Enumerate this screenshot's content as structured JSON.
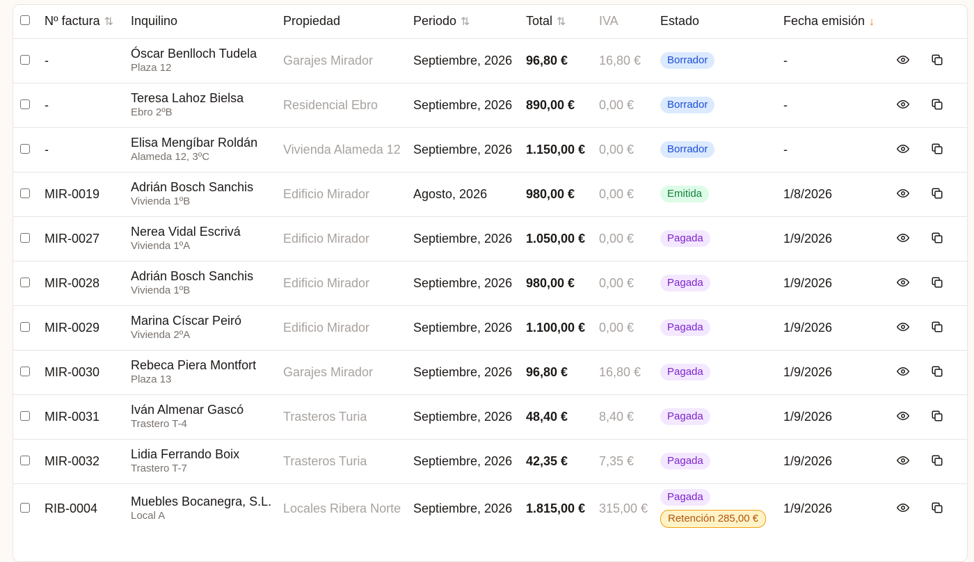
{
  "headers": {
    "invoice_no": "Nº factura",
    "tenant": "Inquilino",
    "property": "Propiedad",
    "period": "Periodo",
    "total": "Total",
    "vat": "IVA",
    "status": "Estado",
    "issue_date": "Fecha emisión"
  },
  "icons": {
    "sort": "sort-icon",
    "sort_active": "sort-desc-icon",
    "view": "eye-icon",
    "copy": "copy-icon"
  },
  "colors": {
    "accent": "#f97316",
    "draft": "#1d4ed8",
    "issued": "#15803d",
    "paid": "#7e22ce",
    "retention": "#b45309"
  },
  "rows": [
    {
      "invoice": "-",
      "tenant": "Óscar Benlloch Tudela",
      "unit": "Plaza 12",
      "property": "Garajes Mirador",
      "period": "Septiembre, 2026",
      "total": "96,80 €",
      "vat": "16,80 €",
      "status": "Borrador",
      "status_kind": "draft",
      "date": "-"
    },
    {
      "invoice": "-",
      "tenant": "Teresa Lahoz Bielsa",
      "unit": "Ebro 2ºB",
      "property": "Residencial Ebro",
      "period": "Septiembre, 2026",
      "total": "890,00 €",
      "vat": "0,00 €",
      "status": "Borrador",
      "status_kind": "draft",
      "date": "-"
    },
    {
      "invoice": "-",
      "tenant": "Elisa Mengíbar Roldán",
      "unit": "Alameda 12, 3ºC",
      "property": "Vivienda Alameda 12",
      "period": "Septiembre, 2026",
      "total": "1.150,00 €",
      "vat": "0,00 €",
      "status": "Borrador",
      "status_kind": "draft",
      "date": "-"
    },
    {
      "invoice": "MIR-0019",
      "tenant": "Adrián Bosch Sanchis",
      "unit": "Vivienda 1ºB",
      "property": "Edificio Mirador",
      "period": "Agosto, 2026",
      "total": "980,00 €",
      "vat": "0,00 €",
      "status": "Emitida",
      "status_kind": "issued",
      "date": "1/8/2026"
    },
    {
      "invoice": "MIR-0027",
      "tenant": "Nerea Vidal Escrivá",
      "unit": "Vivienda 1ºA",
      "property": "Edificio Mirador",
      "period": "Septiembre, 2026",
      "total": "1.050,00 €",
      "vat": "0,00 €",
      "status": "Pagada",
      "status_kind": "paid",
      "date": "1/9/2026"
    },
    {
      "invoice": "MIR-0028",
      "tenant": "Adrián Bosch Sanchis",
      "unit": "Vivienda 1ºB",
      "property": "Edificio Mirador",
      "period": "Septiembre, 2026",
      "total": "980,00 €",
      "vat": "0,00 €",
      "status": "Pagada",
      "status_kind": "paid",
      "date": "1/9/2026"
    },
    {
      "invoice": "MIR-0029",
      "tenant": "Marina Císcar Peiró",
      "unit": "Vivienda 2ºA",
      "property": "Edificio Mirador",
      "period": "Septiembre, 2026",
      "total": "1.100,00 €",
      "vat": "0,00 €",
      "status": "Pagada",
      "status_kind": "paid",
      "date": "1/9/2026"
    },
    {
      "invoice": "MIR-0030",
      "tenant": "Rebeca Piera Montfort",
      "unit": "Plaza 13",
      "property": "Garajes Mirador",
      "period": "Septiembre, 2026",
      "total": "96,80 €",
      "vat": "16,80 €",
      "status": "Pagada",
      "status_kind": "paid",
      "date": "1/9/2026"
    },
    {
      "invoice": "MIR-0031",
      "tenant": "Iván Almenar Gascó",
      "unit": "Trastero T-4",
      "property": "Trasteros Turia",
      "period": "Septiembre, 2026",
      "total": "48,40 €",
      "vat": "8,40 €",
      "status": "Pagada",
      "status_kind": "paid",
      "date": "1/9/2026"
    },
    {
      "invoice": "MIR-0032",
      "tenant": "Lidia Ferrando Boix",
      "unit": "Trastero T-7",
      "property": "Trasteros Turia",
      "period": "Septiembre, 2026",
      "total": "42,35 €",
      "vat": "7,35 €",
      "status": "Pagada",
      "status_kind": "paid",
      "date": "1/9/2026"
    },
    {
      "invoice": "RIB-0004",
      "tenant": "Muebles Bocanegra, S.L.",
      "unit": "Local A",
      "property": "Locales Ribera Norte",
      "period": "Septiembre, 2026",
      "total": "1.815,00 €",
      "vat": "315,00 €",
      "status": "Pagada",
      "status_kind": "paid",
      "retention": "Retención 285,00 €",
      "date": "1/9/2026"
    }
  ]
}
